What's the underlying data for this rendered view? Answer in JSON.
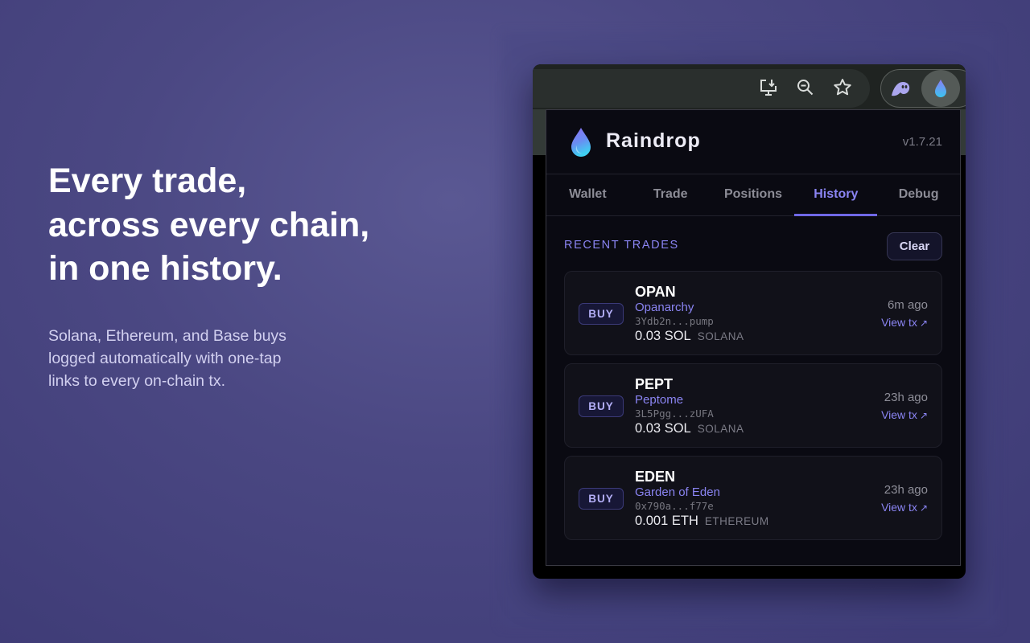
{
  "marketing": {
    "headline": [
      "Every trade,",
      "across every chain,",
      "in one history."
    ],
    "subtext": [
      "Solana, Ethereum, and Base buys",
      "logged automatically with one-tap",
      "links to every on-chain tx."
    ]
  },
  "browser": {
    "toolbar_icons": [
      "install-app-icon",
      "zoom-out-icon",
      "star-icon"
    ],
    "extensions": [
      "ghost-extension-icon",
      "raindrop-extension-icon"
    ]
  },
  "popup": {
    "app_name": "Raindrop",
    "version": "v1.7.21",
    "tabs": [
      {
        "label": "Wallet",
        "active": false
      },
      {
        "label": "Trade",
        "active": false
      },
      {
        "label": "Positions",
        "active": false
      },
      {
        "label": "History",
        "active": true
      },
      {
        "label": "Debug",
        "active": false
      }
    ],
    "section_title": "RECENT TRADES",
    "clear_label": "Clear",
    "trades": [
      {
        "side": "BUY",
        "ticker": "OPAN",
        "name": "Opanarchy",
        "address": "3Ydb2n...pump",
        "amount": "0.03 SOL",
        "chain": "SOLANA",
        "time": "6m ago",
        "link": "View tx"
      },
      {
        "side": "BUY",
        "ticker": "PEPT",
        "name": "Peptome",
        "address": "3L5Pgg...zUFA",
        "amount": "0.03 SOL",
        "chain": "SOLANA",
        "time": "23h ago",
        "link": "View tx"
      },
      {
        "side": "BUY",
        "ticker": "EDEN",
        "name": "Garden of Eden",
        "address": "0x790a...f77e",
        "amount": "0.001 ETH",
        "chain": "ETHEREUM",
        "time": "23h ago",
        "link": "View tx"
      }
    ]
  },
  "colors": {
    "accent": "#8a84f2",
    "background": "#4b4883",
    "popup_bg": "#0a0a12"
  }
}
